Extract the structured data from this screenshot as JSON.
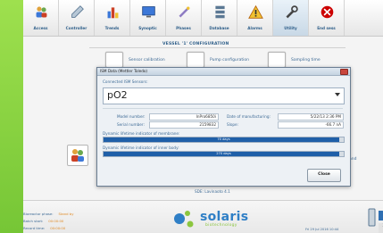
{
  "toolbar": {
    "items": [
      {
        "label": "Access",
        "icon": "users-icon"
      },
      {
        "label": "Controller",
        "icon": "probe-icon"
      },
      {
        "label": "Trends",
        "icon": "bar-chart-icon"
      },
      {
        "label": "Synoptic",
        "icon": "monitor-icon"
      },
      {
        "label": "Phases",
        "icon": "wand-icon"
      },
      {
        "label": "Database",
        "icon": "server-icon"
      },
      {
        "label": "Alarms",
        "icon": "warning-icon"
      },
      {
        "label": "Utility",
        "icon": "wrench-icon"
      },
      {
        "label": "End sess",
        "icon": "exit-icon"
      }
    ],
    "active": "Utility"
  },
  "vessel_title": "VESSEL '1' CONFIGURATION",
  "config_buttons": {
    "sensor_calibration": "Sensor calibration",
    "pump_configuration": "Pump configuration",
    "sampling_time": "Sampling time",
    "command": "or command"
  },
  "dialog": {
    "title": "ISM Data (Mettler Toledo)",
    "connected_label": "Connected ISM Sensors:",
    "selected_sensor": "pO2",
    "model_label": "Model number:",
    "model_value": "InPro6850i",
    "serial_label": "Serial number:",
    "serial_value": "2159832",
    "manufacture_label": "Date of manufacturing:",
    "manufacture_value": "5/22/13 2:36 PM",
    "slope_label": "Slope:",
    "slope_value": "-66.7 nA",
    "membrane_label": "Dynamic lifetime indicator of membrane:",
    "membrane_value": "70 days",
    "membrane_level": 0.98,
    "body_label": "Dynamic lifetime indicator of inner body:",
    "body_value": "270 days",
    "body_level": 0.98,
    "close_label": "Close"
  },
  "sde_label": "SDE: Lavinaoto 4.1",
  "footer": {
    "phase_label": "Bioreactor phase:",
    "phase_value": "Stand by",
    "start_label": "Batch start:",
    "start_value": "00:00:00",
    "record_label": "Record time:",
    "record_value": "00:00:00",
    "logo_text": "solaris",
    "logo_sub": "biotechnology",
    "datetime": "Fri 29 Jul 2016 10:44",
    "tab1": "1",
    "tab3": "3"
  },
  "colors": {
    "accent_blue": "#1f5fa8",
    "brand_green": "#8cc63f",
    "label_blue": "#3d6a95",
    "logo_blue": "#2f7fc6"
  }
}
